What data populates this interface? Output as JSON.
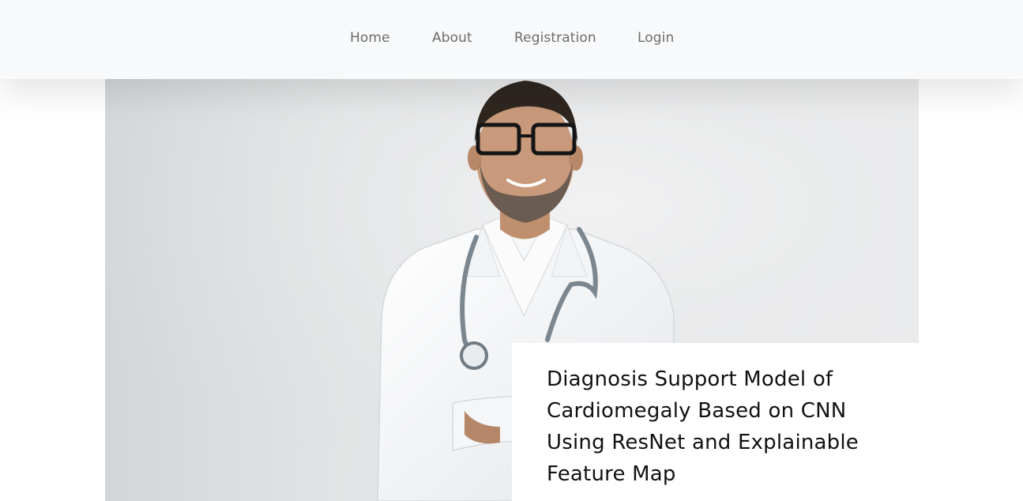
{
  "nav": {
    "items": [
      {
        "label": "Home"
      },
      {
        "label": "About"
      },
      {
        "label": "Registration"
      },
      {
        "label": "Login"
      }
    ]
  },
  "hero": {
    "title": "Diagnosis Support Model of Cardiomegaly Based on CNN Using ResNet and Explainable Feature Map"
  },
  "colors": {
    "navbar_bg": "#f8f9fa",
    "nav_text": "#6c6c6c",
    "title_text": "#111111"
  }
}
